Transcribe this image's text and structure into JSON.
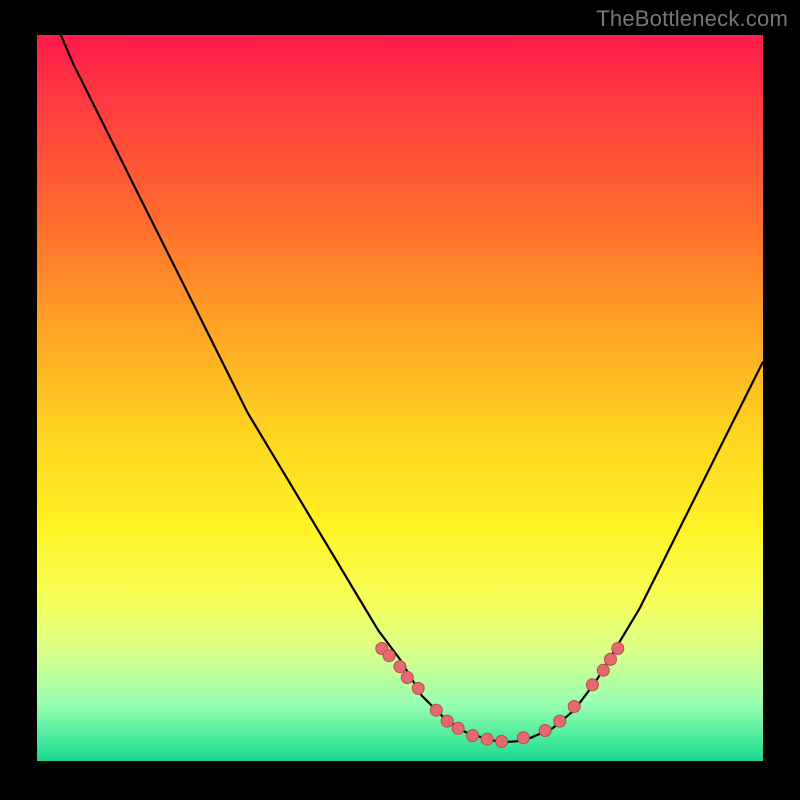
{
  "watermark": "TheBottleneck.com",
  "colors": {
    "background": "#000000",
    "curve": "#000000",
    "marker_fill": "#e46a6f",
    "marker_stroke": "#b94b4f",
    "gradient_top": "#ff1a4b",
    "gradient_bottom": "#1fd68f"
  },
  "chart_data": {
    "type": "line",
    "title": "",
    "xlabel": "",
    "ylabel": "",
    "xlim": [
      0,
      100
    ],
    "ylim": [
      0,
      100
    ],
    "series": [
      {
        "name": "curve",
        "x": [
          0,
          2,
          5,
          8,
          11,
          14,
          17,
          20,
          23,
          26,
          29,
          32,
          35,
          38,
          41,
          44,
          47,
          50,
          53,
          56,
          59,
          62,
          64,
          66,
          68,
          71,
          74,
          77,
          80,
          83,
          86,
          89,
          92,
          95,
          98,
          100
        ],
        "y": [
          108,
          103,
          96,
          90,
          84,
          78,
          72,
          66,
          60,
          54,
          48,
          43,
          38,
          33,
          28,
          23,
          18,
          14,
          9,
          6,
          4,
          3,
          2.6,
          2.7,
          3.2,
          4.5,
          7,
          11,
          16,
          21,
          27,
          33,
          39,
          45,
          51,
          55
        ]
      }
    ],
    "markers": {
      "name": "points",
      "x": [
        47.5,
        48.5,
        50,
        51,
        52.5,
        55,
        56.5,
        58,
        60,
        62,
        64,
        67,
        70,
        72,
        74,
        76.5,
        78,
        79,
        80
      ],
      "y": [
        15.5,
        14.5,
        13,
        11.5,
        10,
        7,
        5.5,
        4.5,
        3.5,
        3,
        2.7,
        3.2,
        4.2,
        5.5,
        7.5,
        10.5,
        12.5,
        14,
        15.5
      ]
    }
  }
}
